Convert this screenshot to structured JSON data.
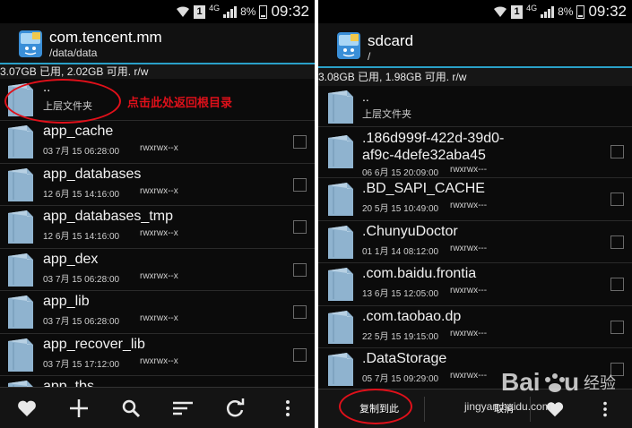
{
  "status_bar": {
    "network": "4G",
    "sim": "1",
    "battery": "8%",
    "time": "09:32"
  },
  "left_panel": {
    "title": "com.tencent.mm",
    "path": "/data/data",
    "storage_info": "3.07GB 已用, 2.02GB 可用. r/w",
    "annotation": "点击此处返回根目录",
    "items": [
      {
        "name": "..",
        "date": "上层文件夹",
        "perm": ""
      },
      {
        "name": "app_cache",
        "date": "03 7月 15 06:28:00",
        "perm": "rwxrwx--x"
      },
      {
        "name": "app_databases",
        "date": "12 6月 15 14:16:00",
        "perm": "rwxrwx--x"
      },
      {
        "name": "app_databases_tmp",
        "date": "12 6月 15 14:16:00",
        "perm": "rwxrwx--x"
      },
      {
        "name": "app_dex",
        "date": "03 7月 15 06:28:00",
        "perm": "rwxrwx--x"
      },
      {
        "name": "app_lib",
        "date": "03 7月 15 06:28:00",
        "perm": "rwxrwx--x"
      },
      {
        "name": "app_recover_lib",
        "date": "03 7月 15 17:12:00",
        "perm": "rwxrwx--x"
      },
      {
        "name": "app_tbs",
        "date": "",
        "perm": ""
      }
    ],
    "toolbar_icons": [
      "heart-icon",
      "plus-icon",
      "search-icon",
      "sort-icon",
      "refresh-icon",
      "more-icon"
    ]
  },
  "right_panel": {
    "title": "sdcard",
    "path": "/",
    "storage_info": "3.08GB 已用, 1.98GB 可用. r/w",
    "items": [
      {
        "name": "..",
        "date": "上层文件夹",
        "perm": ""
      },
      {
        "name": ".186d999f-422d-39d0-af9c-4defe32aba45",
        "date": "06 6月 15 20:09:00",
        "perm": "rwxrwx---"
      },
      {
        "name": ".BD_SAPI_CACHE",
        "date": "20 5月 15 10:49:00",
        "perm": "rwxrwx---"
      },
      {
        "name": ".ChunyuDoctor",
        "date": "01 1月 14 08:12:00",
        "perm": "rwxrwx---"
      },
      {
        "name": ".com.baidu.frontia",
        "date": "13 6月 15 12:05:00",
        "perm": "rwxrwx---"
      },
      {
        "name": ".com.taobao.dp",
        "date": "22 5月 15 19:15:00",
        "perm": "rwxrwx---"
      },
      {
        "name": ".DataStorage",
        "date": "05 7月 15 09:29:00",
        "perm": "rwxrwx---"
      }
    ],
    "copy_button": "复制到此",
    "cancel_button": "取消",
    "watermark": "jingyan.baidu.com"
  },
  "colors": {
    "accent": "#2aa0c8",
    "annotation": "#e0101a",
    "folder": "#8fb3cf"
  }
}
